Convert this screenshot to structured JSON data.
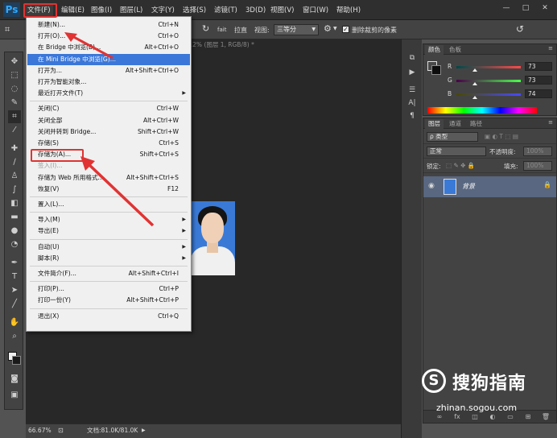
{
  "app": {
    "logo": "Ps",
    "menus": [
      "文件(F)",
      "编辑(E)",
      "图像(I)",
      "图层(L)",
      "文字(Y)",
      "选择(S)",
      "滤镜(T)",
      "3D(D)",
      "视图(V)",
      "窗口(W)",
      "帮助(H)"
    ],
    "window_controls": [
      "—",
      "□",
      "✕"
    ]
  },
  "options_bar": {
    "icon_label": "fait",
    "straighten": "拉直",
    "view_label": "视图:",
    "view_value": "三等分",
    "delete_crop_checked": true,
    "delete_crop_label": "删除裁剪的像素"
  },
  "document": {
    "tab_text": "4.2% (图层 1, RGB/8) *",
    "zoom": "66.67%",
    "doc_size": "文档:81.0K/81.0K"
  },
  "file_menu": {
    "items": [
      {
        "label": "新建(N)...",
        "shortcut": "Ctrl+N"
      },
      {
        "label": "打开(O)...",
        "shortcut": "Ctrl+O"
      },
      {
        "label": "在 Bridge 中浏览(B)...",
        "shortcut": "Alt+Ctrl+O"
      },
      {
        "label": "在 Mini Bridge 中浏览(G)...",
        "shortcut": "",
        "highlighted": true
      },
      {
        "label": "打开为...",
        "shortcut": "Alt+Shift+Ctrl+O"
      },
      {
        "label": "打开为智能对象...",
        "shortcut": ""
      },
      {
        "label": "最近打开文件(T)",
        "shortcut": "",
        "submenu": true
      },
      {
        "separator": true
      },
      {
        "label": "关闭(C)",
        "shortcut": "Ctrl+W"
      },
      {
        "label": "关闭全部",
        "shortcut": "Alt+Ctrl+W"
      },
      {
        "label": "关闭并转到 Bridge...",
        "shortcut": "Shift+Ctrl+W"
      },
      {
        "label": "存储(S)",
        "shortcut": "Ctrl+S"
      },
      {
        "label": "存储为(A)...",
        "shortcut": "Shift+Ctrl+S",
        "boxed": true
      },
      {
        "label": "签入(I)...",
        "shortcut": "",
        "disabled": true
      },
      {
        "label": "存储为 Web 所用格式...",
        "shortcut": "Alt+Shift+Ctrl+S"
      },
      {
        "label": "恢复(V)",
        "shortcut": "F12"
      },
      {
        "separator": true
      },
      {
        "label": "置入(L)...",
        "shortcut": ""
      },
      {
        "separator": true
      },
      {
        "label": "导入(M)",
        "shortcut": "",
        "submenu": true
      },
      {
        "label": "导出(E)",
        "shortcut": "",
        "submenu": true
      },
      {
        "separator": true
      },
      {
        "label": "自动(U)",
        "shortcut": "",
        "submenu": true
      },
      {
        "label": "脚本(R)",
        "shortcut": "",
        "submenu": true
      },
      {
        "separator": true
      },
      {
        "label": "文件简介(F)...",
        "shortcut": "Alt+Shift+Ctrl+I"
      },
      {
        "separator": true
      },
      {
        "label": "打印(P)...",
        "shortcut": "Ctrl+P"
      },
      {
        "label": "打印一份(Y)",
        "shortcut": "Alt+Shift+Ctrl+P"
      },
      {
        "separator": true
      },
      {
        "label": "退出(X)",
        "shortcut": "Ctrl+Q"
      }
    ]
  },
  "color_panel": {
    "tabs": [
      "颜色",
      "色板"
    ],
    "r_label": "R",
    "g_label": "G",
    "b_label": "B",
    "r": "73",
    "g": "73",
    "b": "74",
    "r_level": 0.286,
    "g_level": 0.286,
    "b_level": 0.29
  },
  "layers_panel": {
    "tabs": [
      "图层",
      "通道",
      "路径"
    ],
    "filter_type": "ρ 类型",
    "blend_mode": "正常",
    "opacity_label": "不透明度:",
    "opacity_value": "100%",
    "lock_label": "锁定:",
    "fill_label": "填充:",
    "fill_value": "100%",
    "layer_name": "背景"
  },
  "watermark": {
    "logo": "S",
    "name": "搜狗指南",
    "url": "zhinan.sogou.com"
  },
  "colors": {
    "highlight": "#3b77d8",
    "annotation_red": "#e03333"
  }
}
